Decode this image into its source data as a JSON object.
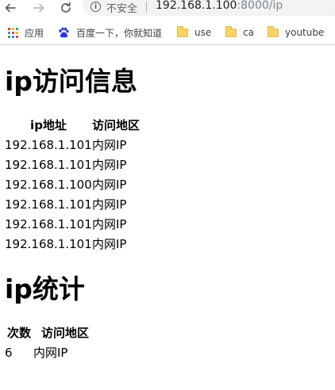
{
  "browser": {
    "security_label": "不安全",
    "url_host": "192.168.1.100",
    "url_rest": ":8000/ip"
  },
  "bookmarks": [
    {
      "label": "应用",
      "icon": "apps-grid-icon"
    },
    {
      "label": "百度一下，你就知道",
      "icon": "baidu-paw-icon"
    },
    {
      "label": "use",
      "icon": "folder-icon"
    },
    {
      "label": "ca",
      "icon": "folder-icon"
    },
    {
      "label": "youtube",
      "icon": "folder-icon"
    }
  ],
  "page": {
    "title_access": "ip访问信息",
    "access_table": {
      "headers": [
        "ip地址",
        "访问地区"
      ],
      "rows": [
        [
          "192.168.1.101",
          "内网IP"
        ],
        [
          "192.168.1.101",
          "内网IP"
        ],
        [
          "192.168.1.100",
          "内网IP"
        ],
        [
          "192.168.1.101",
          "内网IP"
        ],
        [
          "192.168.1.101",
          "内网IP"
        ],
        [
          "192.168.1.101",
          "内网IP"
        ]
      ]
    },
    "title_stats": "ip统计",
    "stats_table": {
      "headers": [
        "次数",
        "访问地区"
      ],
      "rows": [
        [
          "6",
          "内网IP"
        ]
      ]
    }
  }
}
